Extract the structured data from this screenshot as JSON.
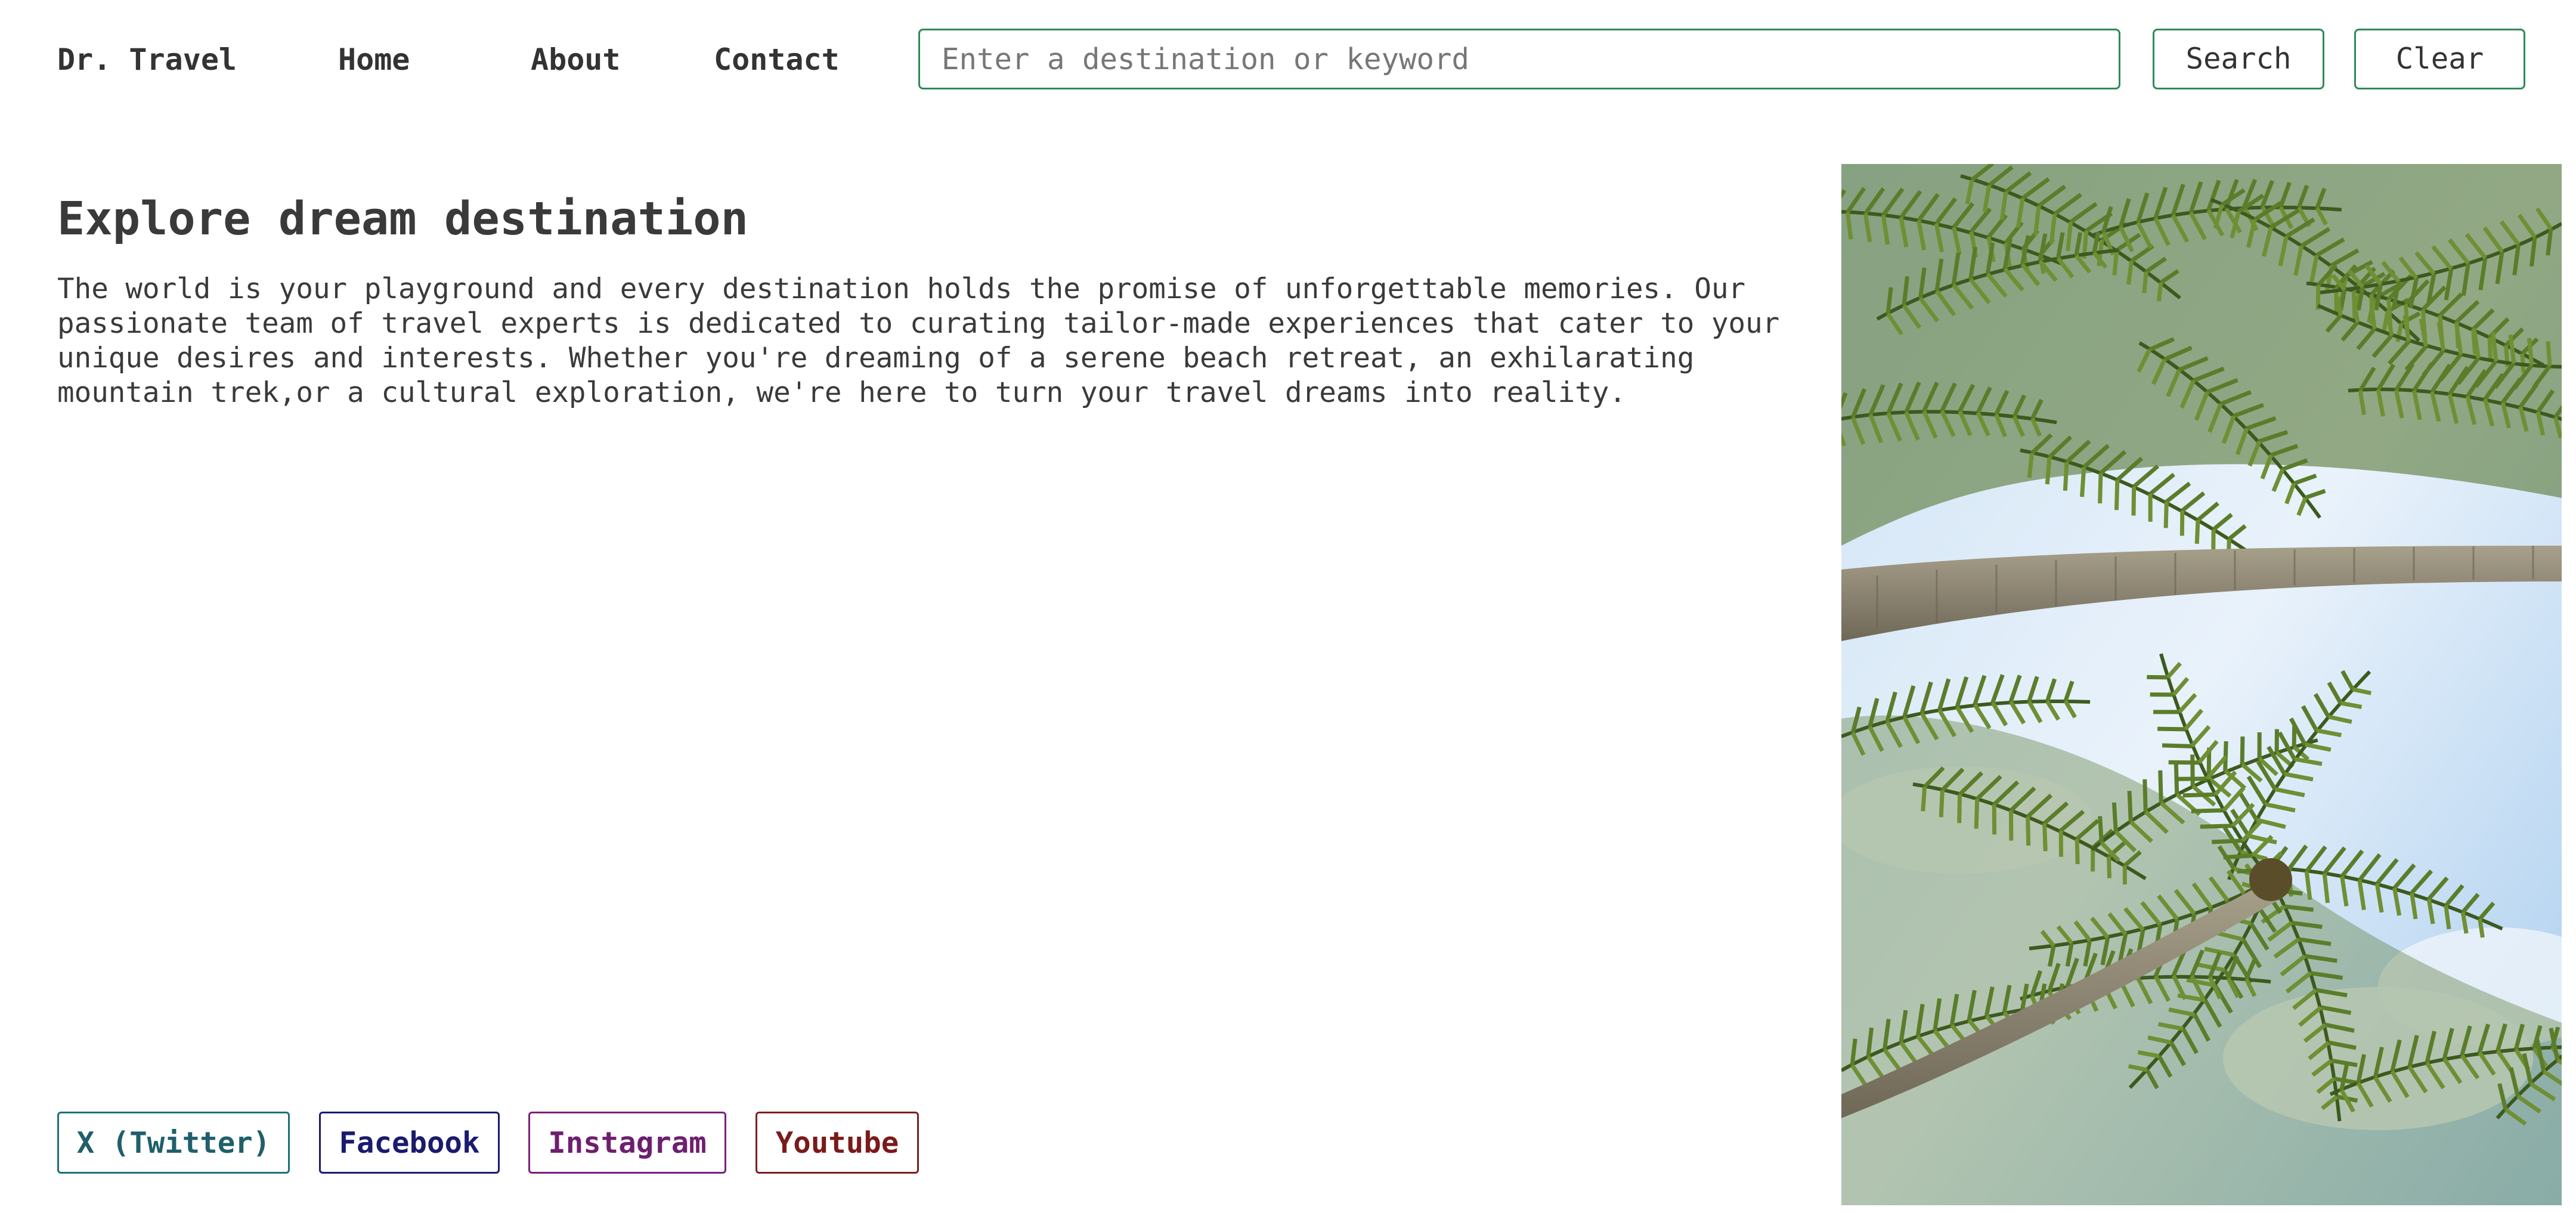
{
  "header": {
    "brand": "Dr. Travel",
    "nav": {
      "home": "Home",
      "about": "About",
      "contact": "Contact"
    },
    "search": {
      "placeholder": "Enter a destination or keyword",
      "value": ""
    },
    "search_button": "Search",
    "clear_button": "Clear"
  },
  "main": {
    "title": "Explore dream destination",
    "description": "The world is your playground and every destination holds the promise of unforgettable memories. Our passionate team of travel experts is dedicated to curating tailor-made experiences that cater to your unique desires and interests. Whether you're dreaming of a serene beach retreat, an exhilarating mountain trek,or a cultural exploration, we're here to turn your travel dreams into reality."
  },
  "social": {
    "twitter": "X (Twitter)",
    "facebook": "Facebook",
    "instagram": "Instagram",
    "youtube": "Youtube"
  },
  "colors": {
    "accent_border": "#2e8b57",
    "text": "#3a3a3a",
    "twitter": "#1f5f6a",
    "facebook": "#1a1a6e",
    "instagram": "#6e1f6e",
    "youtube": "#7a1a1a"
  },
  "hero_image": {
    "subject": "palm trees against a blue sky"
  }
}
